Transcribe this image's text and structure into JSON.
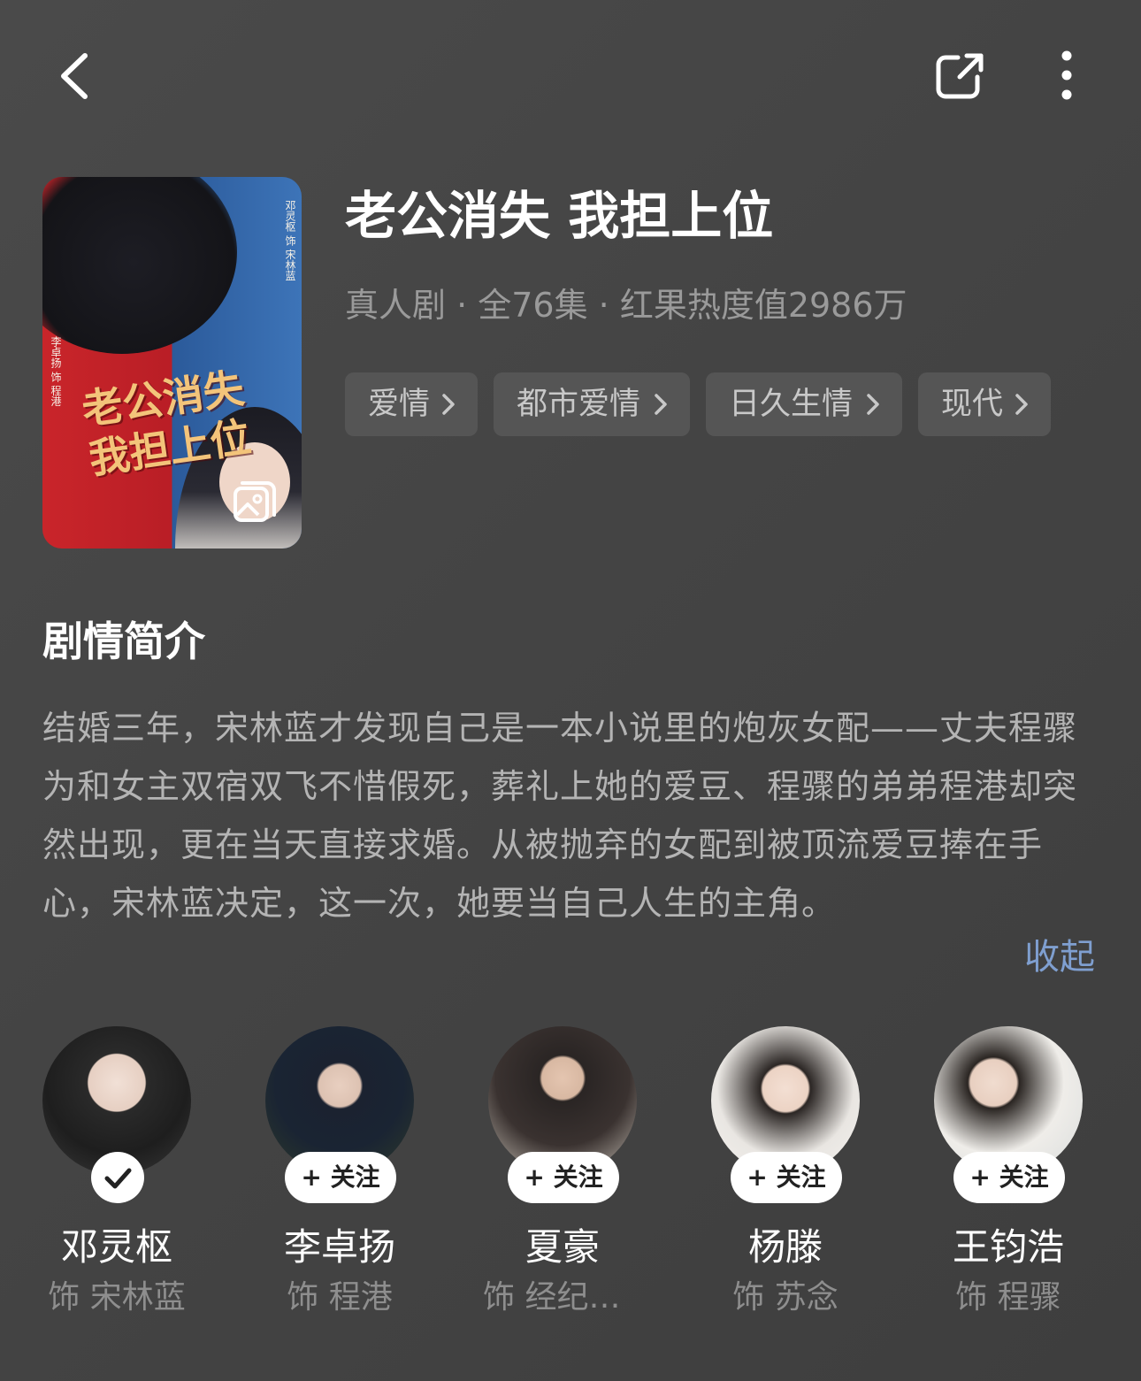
{
  "header": {
    "back_icon": "chevron-left-icon",
    "share_icon": "share-icon",
    "more_icon": "more-vertical-icon"
  },
  "poster": {
    "calligraphy": "老公消失我担上位",
    "vertical_right": "邓灵枢 饰 宋林蓝",
    "vertical_left": "李卓扬 饰 程港",
    "gallery_icon": "gallery-icon"
  },
  "drama": {
    "title": "老公消失 我担上位",
    "meta": "真人剧 · 全76集 · 红果热度值2986万",
    "tags": [
      "爱情",
      "都市爱情",
      "日久生情",
      "现代"
    ]
  },
  "synopsis": {
    "heading": "剧情简介",
    "text": "结婚三年，宋林蓝才发现自己是一本小说里的炮灰女配——丈夫程骤为和女主双宿双飞不惜假死，葬礼上她的爱豆、程骤的弟弟程港却突然出现，更在当天直接求婚。从被抛弃的女配到被顶流爱豆捧在手心，宋林蓝决定，这一次，她要当自己人生的主角。",
    "collapse_label": "收起"
  },
  "cast": [
    {
      "name": "邓灵枢",
      "role": "饰 宋林蓝",
      "followed": true,
      "follow_label": ""
    },
    {
      "name": "李卓扬",
      "role": "饰 程港",
      "followed": false,
      "follow_label": "+ 关注"
    },
    {
      "name": "夏豪",
      "role": "饰 经纪人...",
      "followed": false,
      "follow_label": "+ 关注"
    },
    {
      "name": "杨滕",
      "role": "饰 苏念",
      "followed": false,
      "follow_label": "+ 关注"
    },
    {
      "name": "王钧浩",
      "role": "饰 程骤",
      "followed": false,
      "follow_label": "+ 关注"
    }
  ],
  "colors": {
    "background": "#444444",
    "tag_bg": "#555555",
    "link": "#7f9fd0",
    "muted_text": "#9a9a9a"
  }
}
